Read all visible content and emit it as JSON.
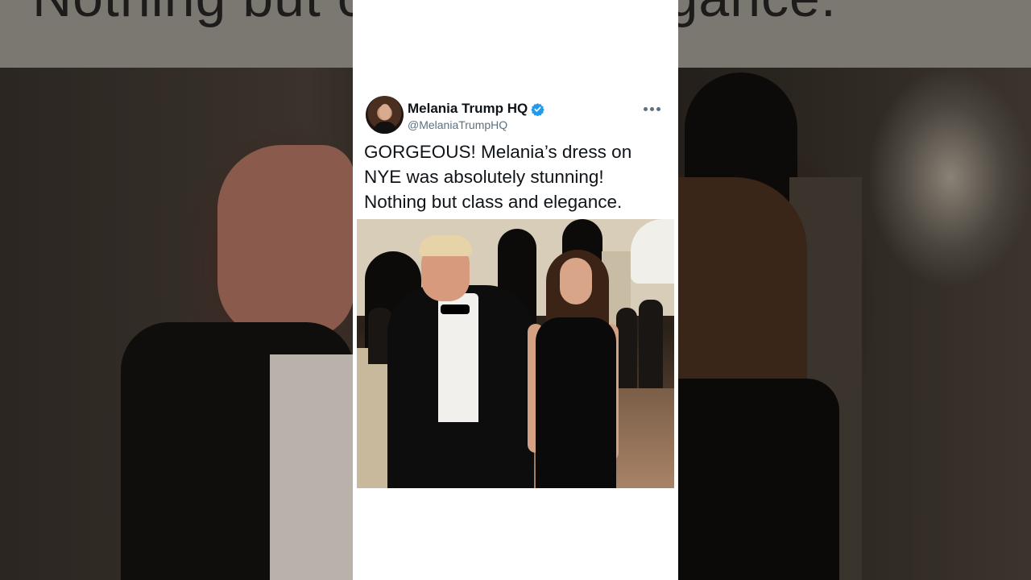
{
  "background": {
    "headline_text": "Nothing but class and elegance."
  },
  "tweet": {
    "display_name": "Melania Trump HQ",
    "handle": "@MelaniaTrumpHQ",
    "verified": true,
    "text": "GORGEOUS! Melania’s dress on NYE was absolutely stunning! Nothing but class and elegance.",
    "icons": {
      "verified": "verified-badge-icon",
      "more": "more-options-icon"
    },
    "colors": {
      "verified_blue": "#1d9bf0",
      "text": "#0f1419",
      "secondary": "#5b7083",
      "card_bg": "#ffffff"
    }
  }
}
